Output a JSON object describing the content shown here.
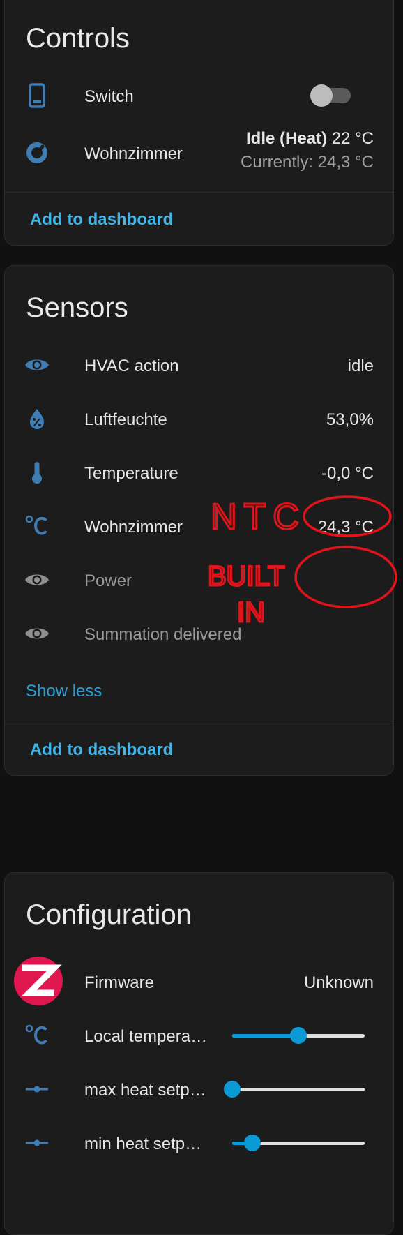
{
  "colors": {
    "accent": "#3fb6ea",
    "icon": "#3f7db4",
    "slider": "#0a9bd6",
    "annotation": "#e0141a"
  },
  "controls": {
    "title": "Controls",
    "switch": {
      "label": "Switch",
      "icon": "tablet-switch-icon",
      "on": false
    },
    "thermostat": {
      "label": "Wohnzimmer",
      "icon": "thermostat-dial-icon",
      "state": "Idle (Heat)",
      "target": "22 °C",
      "current": "Currently: 24,3 °C"
    },
    "add_label": "Add to dashboard"
  },
  "sensors": {
    "title": "Sensors",
    "rows": [
      {
        "icon": "eye-icon",
        "label": "HVAC action",
        "value": "idle"
      },
      {
        "icon": "humidity-percent-icon",
        "label": "Luftfeuchte",
        "value": "53,0%"
      },
      {
        "icon": "thermometer-icon",
        "label": "Temperature",
        "value": "-0,0 °C"
      },
      {
        "icon": "celsius-icon",
        "label": "Wohnzimmer",
        "value": "24,3 °C"
      },
      {
        "icon": "eye-icon",
        "label": "Power",
        "value": ""
      },
      {
        "icon": "eye-icon",
        "label": "Summation delivered",
        "value": ""
      }
    ],
    "show_less": "Show less",
    "add_label": "Add to dashboard"
  },
  "annotations": {
    "ntc": "NTC",
    "built_in_1": "BUILT",
    "built_in_2": "IN"
  },
  "configuration": {
    "title": "Configuration",
    "firmware": {
      "icon": "zigbee-logo-icon",
      "label": "Firmware",
      "value": "Unknown"
    },
    "sliders": [
      {
        "icon": "celsius-icon",
        "label": "Local tempera…",
        "level": 0.5
      },
      {
        "icon": "slider-icon",
        "label": "max heat setp…",
        "level": 0.0
      },
      {
        "icon": "slider-icon",
        "label": "min heat setp…",
        "level": 0.15
      }
    ]
  }
}
